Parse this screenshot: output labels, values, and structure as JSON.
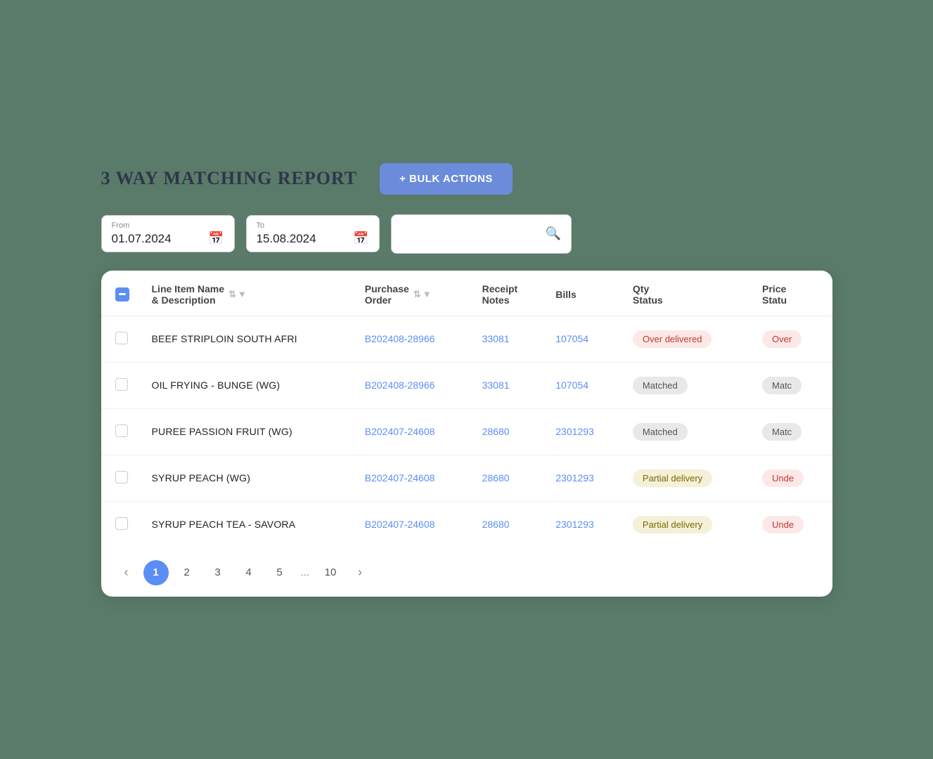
{
  "header": {
    "title": "3 WAY MATCHING REPORT",
    "bulk_actions_label": "+ BULK ACTIONS"
  },
  "filters": {
    "from_label": "From",
    "from_value": "01.07.2024",
    "to_label": "To",
    "to_value": "15.08.2024",
    "search_placeholder": ""
  },
  "table": {
    "columns": [
      {
        "id": "checkbox",
        "label": ""
      },
      {
        "id": "line_item",
        "label": "Line Item Name & Description"
      },
      {
        "id": "purchase_order",
        "label": "Purchase Order"
      },
      {
        "id": "receipt_notes",
        "label": "Receipt Notes"
      },
      {
        "id": "bills",
        "label": "Bills"
      },
      {
        "id": "qty_status",
        "label": "Qty Status"
      },
      {
        "id": "price_status",
        "label": "Price Statu"
      }
    ],
    "rows": [
      {
        "id": 1,
        "line_item": "BEEF STRIPLOIN SOUTH AFRI",
        "purchase_order": "B202408-28966",
        "receipt_notes": "33081",
        "bills": "107054",
        "qty_status": "Over delivered",
        "qty_status_type": "over",
        "price_status": "Over",
        "price_status_type": "over"
      },
      {
        "id": 2,
        "line_item": "OIL FRYING - BUNGE (WG)",
        "purchase_order": "B202408-28966",
        "receipt_notes": "33081",
        "bills": "107054",
        "qty_status": "Matched",
        "qty_status_type": "matched",
        "price_status": "Matc",
        "price_status_type": "matched"
      },
      {
        "id": 3,
        "line_item": "PUREE PASSION FRUIT (WG)",
        "purchase_order": "B202407-24608",
        "receipt_notes": "28680",
        "bills": "2301293",
        "qty_status": "Matched",
        "qty_status_type": "matched",
        "price_status": "Matc",
        "price_status_type": "matched"
      },
      {
        "id": 4,
        "line_item": "SYRUP PEACH (WG)",
        "purchase_order": "B202407-24608",
        "receipt_notes": "28680",
        "bills": "2301293",
        "qty_status": "Partial delivery",
        "qty_status_type": "partial",
        "price_status": "Unde",
        "price_status_type": "under"
      },
      {
        "id": 5,
        "line_item": "SYRUP PEACH TEA - SAVORA",
        "purchase_order": "B202407-24608",
        "receipt_notes": "28680",
        "bills": "2301293",
        "qty_status": "Partial delivery",
        "qty_status_type": "partial",
        "price_status": "Unde",
        "price_status_type": "under"
      }
    ]
  },
  "pagination": {
    "prev_label": "‹",
    "next_label": "›",
    "pages": [
      "1",
      "2",
      "3",
      "4",
      "5"
    ],
    "ellipsis": "...",
    "last_page": "10",
    "active_page": "1"
  }
}
